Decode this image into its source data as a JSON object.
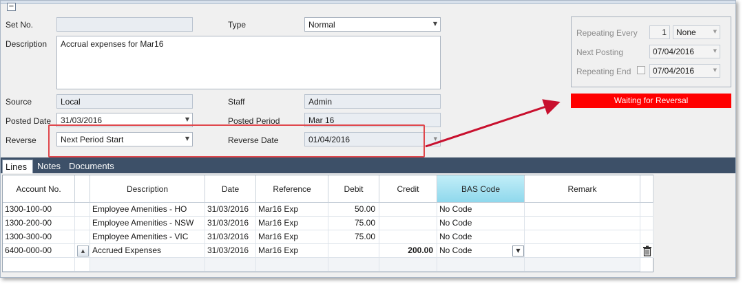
{
  "header": {
    "collapse_symbol": "−"
  },
  "form": {
    "set_no": {
      "label": "Set No.",
      "value": ""
    },
    "type": {
      "label": "Type",
      "value": "Normal"
    },
    "description": {
      "label": "Description",
      "value": "Accrual expenses for Mar16"
    },
    "source": {
      "label": "Source",
      "value": "Local"
    },
    "staff": {
      "label": "Staff",
      "value": "Admin"
    },
    "posted_date": {
      "label": "Posted Date",
      "value": "31/03/2016"
    },
    "posted_period": {
      "label": "Posted Period",
      "value": "Mar 16"
    },
    "reverse": {
      "label": "Reverse",
      "value": "Next Period Start"
    },
    "reverse_date": {
      "label": "Reverse Date",
      "value": "01/04/2016"
    }
  },
  "repeating": {
    "every_label": "Repeating Every",
    "every_value": "1",
    "every_unit": "None",
    "next_posting_label": "Next Posting",
    "next_posting_value": "07/04/2016",
    "end_label": "Repeating End",
    "end_value": "07/04/2016"
  },
  "status": {
    "text": "Waiting for Reversal",
    "color": "#ff0000"
  },
  "tabs": [
    {
      "label": "Lines",
      "active": true
    },
    {
      "label": "Notes",
      "active": false
    },
    {
      "label": "Documents",
      "active": false
    }
  ],
  "grid": {
    "columns": [
      "Account No.",
      "",
      "Description",
      "Date",
      "Reference",
      "Debit",
      "Credit",
      "BAS Code",
      "Remark"
    ],
    "rows": [
      [
        "1300-100-00",
        "",
        "Employee Amenities - HO",
        "31/03/2016",
        "Mar16 Exp",
        "50.00",
        "",
        "No Code",
        ""
      ],
      [
        "1300-200-00",
        "",
        "Employee Amenities - NSW",
        "31/03/2016",
        "Mar16 Exp",
        "75.00",
        "",
        "No Code",
        ""
      ],
      [
        "1300-300-00",
        "",
        "Employee Amenities - VIC",
        "31/03/2016",
        "Mar16 Exp",
        "75.00",
        "",
        "No Code",
        ""
      ],
      [
        "6400-000-00",
        "",
        "Accrued Expenses",
        "31/03/2016",
        "Mar16 Exp",
        "",
        "200.00",
        "No Code",
        ""
      ]
    ]
  },
  "icons": {
    "collapse": "minus-icon",
    "dropdown": "chevron-down-icon",
    "expander": "triangle-up-icon",
    "delete": "trash-icon"
  },
  "colors": {
    "tab_bar": "#3d5068",
    "highlight_border": "#e0474c",
    "annotation_arrow": "#c8102e",
    "bas_header": "#8fd8ec"
  }
}
